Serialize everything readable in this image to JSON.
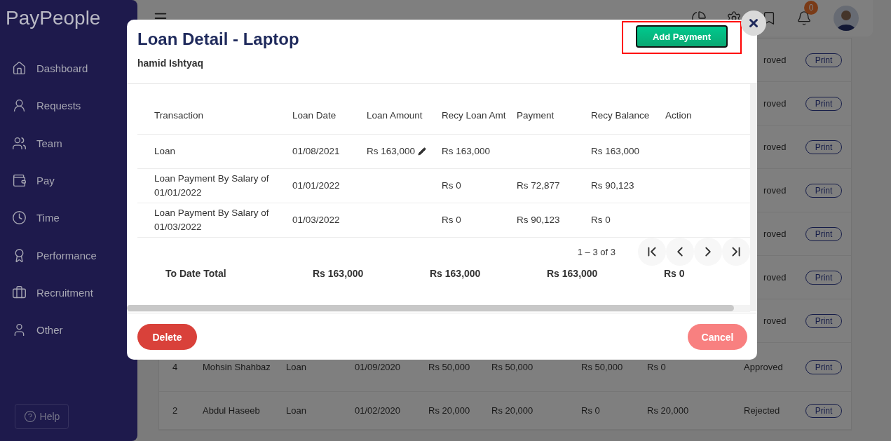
{
  "sidebar": {
    "logo": "PayPeople",
    "items": [
      {
        "label": "Dashboard"
      },
      {
        "label": "Requests"
      },
      {
        "label": "Team"
      },
      {
        "label": "Pay"
      },
      {
        "label": "Time"
      },
      {
        "label": "Performance"
      },
      {
        "label": "Recruitment"
      },
      {
        "label": "Other"
      }
    ],
    "help": "Help"
  },
  "header": {
    "notification_count": "0"
  },
  "background_table": {
    "rows": [
      {
        "kind": "partial",
        "status": "roved",
        "action": "Print"
      },
      {
        "kind": "partial",
        "status": "roved",
        "action": "Print"
      },
      {
        "kind": "partial",
        "status": "roved",
        "action": "Print"
      },
      {
        "kind": "partial",
        "status": "roved",
        "action": "Print"
      },
      {
        "kind": "partial",
        "status": "roved",
        "action": "Print"
      },
      {
        "kind": "partial",
        "status": "roved",
        "action": "Print"
      },
      {
        "kind": "partial",
        "status": "roved",
        "action": "Print"
      },
      {
        "kind": "full",
        "cells": [
          "4",
          "Mohsin Shahbaz",
          "Loan",
          "01/09/2020",
          "Rs 50,000",
          "Rs 50,000",
          "Rs 50,000",
          "Rs 0"
        ],
        "status": "Approved",
        "action": "Print"
      },
      {
        "kind": "full",
        "cells": [
          "2",
          "Abdul Haseeb",
          "Loan",
          "01/02/2020",
          "Rs 20,000",
          "Rs 20,000",
          "Rs 0",
          "Rs 20,000"
        ],
        "status": "Rejected",
        "action": "Print"
      }
    ]
  },
  "dialog": {
    "title": "Loan Detail - Laptop",
    "subtitle": "hamid Ishtyaq",
    "primary_action": "Add Payment",
    "table": {
      "columns": [
        "Transaction",
        "Loan Date",
        "Loan Amount",
        "Recy Loan Amt",
        "Payment",
        "Recy Balance",
        "Action"
      ],
      "rows": [
        {
          "transaction": "Loan",
          "loan_date": "01/08/2021",
          "loan_amount": "Rs 163,000",
          "amount_editable": true,
          "recy_loan_amt": "Rs 163,000",
          "recy_balance": "Rs 163,000"
        },
        {
          "transaction": "Loan Payment By Salary of 01/01/2022",
          "loan_date": "01/01/2022",
          "amount_editable": false,
          "recy_loan_amt": "Rs 0",
          "payment": "Rs 72,877",
          "recy_balance": "Rs 90,123"
        },
        {
          "transaction": "Loan Payment By Salary of 01/03/2022",
          "loan_date": "01/03/2022",
          "amount_editable": false,
          "recy_loan_amt": "Rs 0",
          "payment": "Rs 90,123",
          "recy_balance": "Rs 0"
        }
      ],
      "pagination": "1 – 3 of 3",
      "totals": {
        "label": "To Date Total",
        "values": [
          "Rs 163,000",
          "Rs 163,000",
          "Rs 163,000",
          "Rs 0"
        ]
      }
    },
    "buttons": {
      "delete": "Delete",
      "cancel": "Cancel"
    }
  }
}
